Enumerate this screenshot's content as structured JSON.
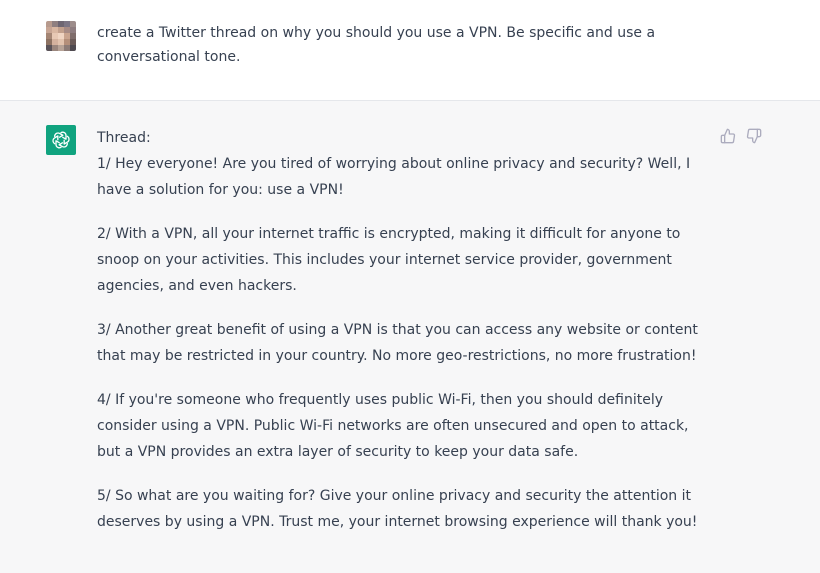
{
  "user_message": {
    "text": "create a Twitter thread on why you should you use a VPN. Be specific and use a conversational  tone."
  },
  "assistant_message": {
    "heading": "Thread:",
    "paragraphs": [
      "1/ Hey everyone! Are you tired of worrying about online privacy and security? Well, I have a solution for you: use a VPN!",
      "2/ With a VPN, all your internet traffic is encrypted, making it difficult for anyone to snoop on your activities. This includes your internet service provider, government agencies, and even hackers.",
      "3/ Another great benefit of using a VPN is that you can access any website or content that may be restricted in your country. No more geo-restrictions, no more frustration!",
      "4/ If you're someone who frequently uses public Wi-Fi, then you should definitely consider using a VPN. Public Wi-Fi networks are often unsecured and open to attack, but a VPN provides an extra layer of security to keep your data safe.",
      "5/ So what are you waiting for? Give your online privacy and security the attention it deserves by using a VPN. Trust me, your internet browsing experience will thank you!"
    ]
  },
  "icons": {
    "user_avatar": "pixelated-user-avatar",
    "assistant_avatar": "openai-logo-icon",
    "feedback_up": "thumbs-up-icon",
    "feedback_down": "thumbs-down-icon"
  },
  "colors": {
    "assistant_background": "#f7f7f8",
    "assistant_avatar": "#10a37f",
    "text": "#374151",
    "icon": "#acacbe"
  }
}
